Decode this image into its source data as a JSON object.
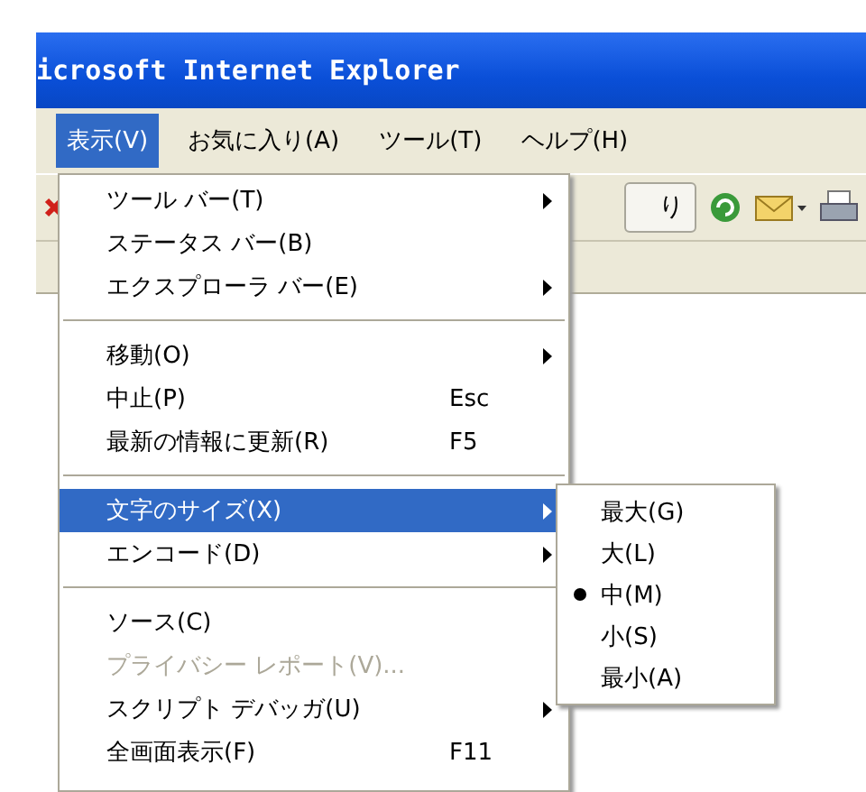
{
  "window": {
    "title": "icrosoft Internet Explorer"
  },
  "menubar": [
    {
      "label": "表示(V)",
      "selected": true
    },
    {
      "label": "お気に入り(A)",
      "selected": false
    },
    {
      "label": "ツール(T)",
      "selected": false
    },
    {
      "label": "ヘルプ(H)",
      "selected": false
    }
  ],
  "toolbar": {
    "button_label": "り"
  },
  "menu": {
    "items": [
      {
        "kind": "item",
        "label": "ツール バー(T)",
        "submenu": true,
        "selected": false,
        "disabled": false
      },
      {
        "kind": "item",
        "label": "ステータス バー(B)",
        "submenu": false,
        "selected": false,
        "disabled": false
      },
      {
        "kind": "item",
        "label": "エクスプローラ バー(E)",
        "submenu": true,
        "selected": false,
        "disabled": false
      },
      {
        "kind": "separator"
      },
      {
        "kind": "item",
        "label": "移動(O)",
        "submenu": true,
        "selected": false,
        "disabled": false
      },
      {
        "kind": "item",
        "label": "中止(P)",
        "shortcut": "Esc",
        "submenu": false,
        "selected": false,
        "disabled": false
      },
      {
        "kind": "item",
        "label": "最新の情報に更新(R)",
        "shortcut": "F5",
        "submenu": false,
        "selected": false,
        "disabled": false
      },
      {
        "kind": "separator"
      },
      {
        "kind": "item",
        "label": "文字のサイズ(X)",
        "submenu": true,
        "selected": true,
        "disabled": false
      },
      {
        "kind": "item",
        "label": "エンコード(D)",
        "submenu": true,
        "selected": false,
        "disabled": false
      },
      {
        "kind": "separator"
      },
      {
        "kind": "item",
        "label": "ソース(C)",
        "submenu": false,
        "selected": false,
        "disabled": false
      },
      {
        "kind": "item",
        "label": "プライバシー レポート(V)...",
        "submenu": false,
        "selected": false,
        "disabled": true
      },
      {
        "kind": "item",
        "label": "スクリプト デバッガ(U)",
        "submenu": true,
        "selected": false,
        "disabled": false
      },
      {
        "kind": "item",
        "label": "全画面表示(F)",
        "shortcut": "F11",
        "submenu": false,
        "selected": false,
        "disabled": false
      }
    ]
  },
  "submenu": {
    "items": [
      {
        "label": "最大(G)",
        "checked": false
      },
      {
        "label": "大(L)",
        "checked": false
      },
      {
        "label": "中(M)",
        "checked": true
      },
      {
        "label": "小(S)",
        "checked": false
      },
      {
        "label": "最小(A)",
        "checked": false
      }
    ]
  }
}
